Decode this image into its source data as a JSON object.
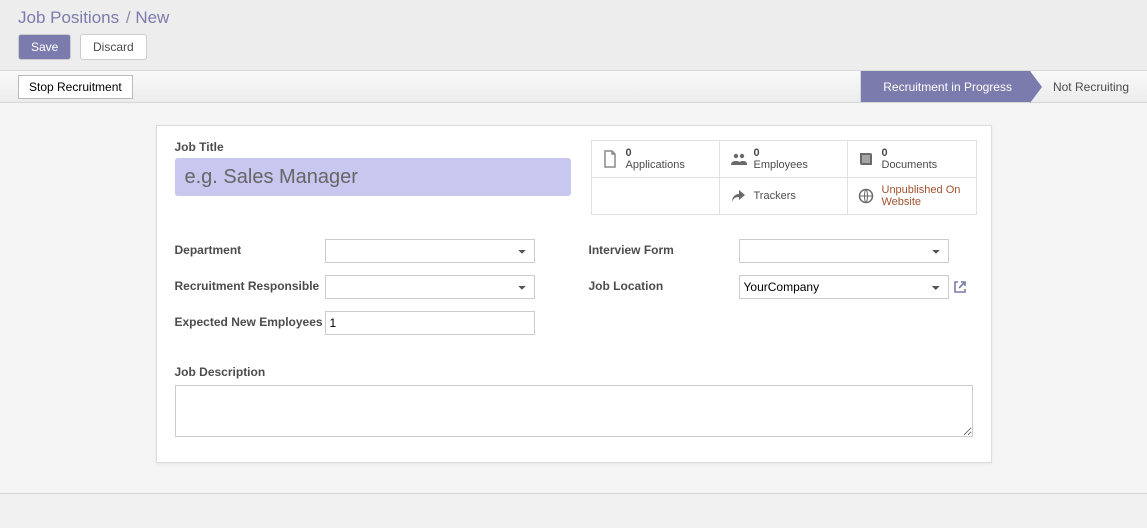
{
  "header": {
    "breadcrumb_main": "Job Positions",
    "breadcrumb_sub": "New",
    "save": "Save",
    "discard": "Discard"
  },
  "statusbar": {
    "stop_recruitment": "Stop Recruitment",
    "stages": [
      {
        "label": "Recruitment in Progress",
        "active": true
      },
      {
        "label": "Not Recruiting",
        "active": false
      }
    ]
  },
  "form": {
    "job_title_label": "Job Title",
    "job_title_placeholder": "e.g. Sales Manager",
    "stats": {
      "applications_count": "0",
      "applications_label": "Applications",
      "employees_count": "0",
      "employees_label": "Employees",
      "documents_count": "0",
      "documents_label": "Documents",
      "trackers_label": "Trackers",
      "website_label": "Unpublished On Website"
    },
    "fields": {
      "department_label": "Department",
      "recruitment_resp_label": "Recruitment Responsible",
      "expected_label": "Expected New Employees",
      "expected_value": "1",
      "interview_form_label": "Interview Form",
      "job_location_label": "Job Location",
      "job_location_value": "YourCompany",
      "job_description_label": "Job Description"
    }
  }
}
